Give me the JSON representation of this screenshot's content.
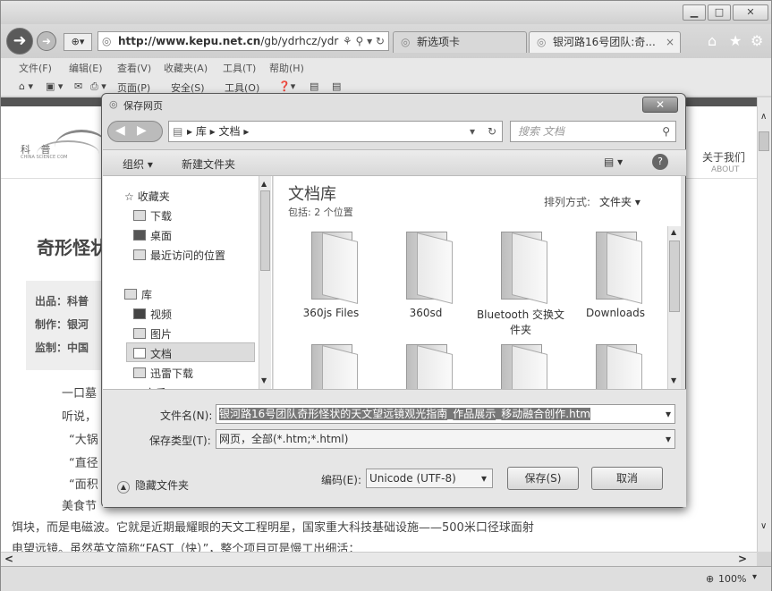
{
  "browser": {
    "url_host": "http://www.kepu.net.cn",
    "url_path": "/gb/ydrhcz/ydrl",
    "tab_new": "新选项卡",
    "tab_active": "银河路16号团队:奇...",
    "zoom": "100%"
  },
  "menus": [
    "文件(F)",
    "编辑(E)",
    "查看(V)",
    "收藏夹(A)",
    "工具(T)",
    "帮助(H)"
  ],
  "commands": [
    "页面(P)",
    "安全(S)",
    "工具(O)"
  ],
  "page": {
    "header_right": "关于我们",
    "header_right_sub": "ABOUT",
    "logo_text": "科 普",
    "logo_sub": "CHINA SCIENCE COM",
    "heading": "奇形怪状",
    "credits": [
      "出品：科普",
      "制作：银河",
      "监制：中国"
    ],
    "para_lines": [
      "一口墓",
      "听说，",
      "“大锅",
      "“直径",
      "“面积",
      "美食节"
    ],
    "bottom_line1": "饵块，而是电磁波。它就是近期最耀眼的天文工程明星，国家重大科技基础设施——500米口径球面射",
    "bottom_line2": "电望远镜。虽然英文简称“FAST（快）”，整个项目可是慢工出细活："
  },
  "dialog": {
    "title": "保存网页",
    "path": [
      "库",
      "文档"
    ],
    "search_placeholder": "搜索 文档",
    "toolbar_organize": "组织 ▾",
    "toolbar_newfolder": "新建文件夹",
    "nav": {
      "favorites": "收藏夹",
      "fav_items": [
        "下载",
        "桌面",
        "最近访问的位置"
      ],
      "libraries": "库",
      "lib_items": [
        "视频",
        "图片",
        "文档",
        "迅雷下载",
        "音乐"
      ]
    },
    "library_title": "文档库",
    "library_sub": "包括: 2 个位置",
    "arrange_label": "排列方式:",
    "arrange_value": "文件夹 ▾",
    "folders": [
      "360js Files",
      "360sd",
      "Bluetooth 交换文件夹",
      "Downloads"
    ],
    "filename_label": "文件名(N):",
    "filename_value": "银河路16号团队奇形怪状的天文望远镜观光指南_作品展示_移动融合创作.htm",
    "type_label": "保存类型(T):",
    "type_value": "网页，全部(*.htm;*.html)",
    "hide_folders": "隐藏文件夹",
    "encoding_label": "编码(E):",
    "encoding_value": "Unicode (UTF-8)",
    "save": "保存(S)",
    "cancel": "取消"
  }
}
